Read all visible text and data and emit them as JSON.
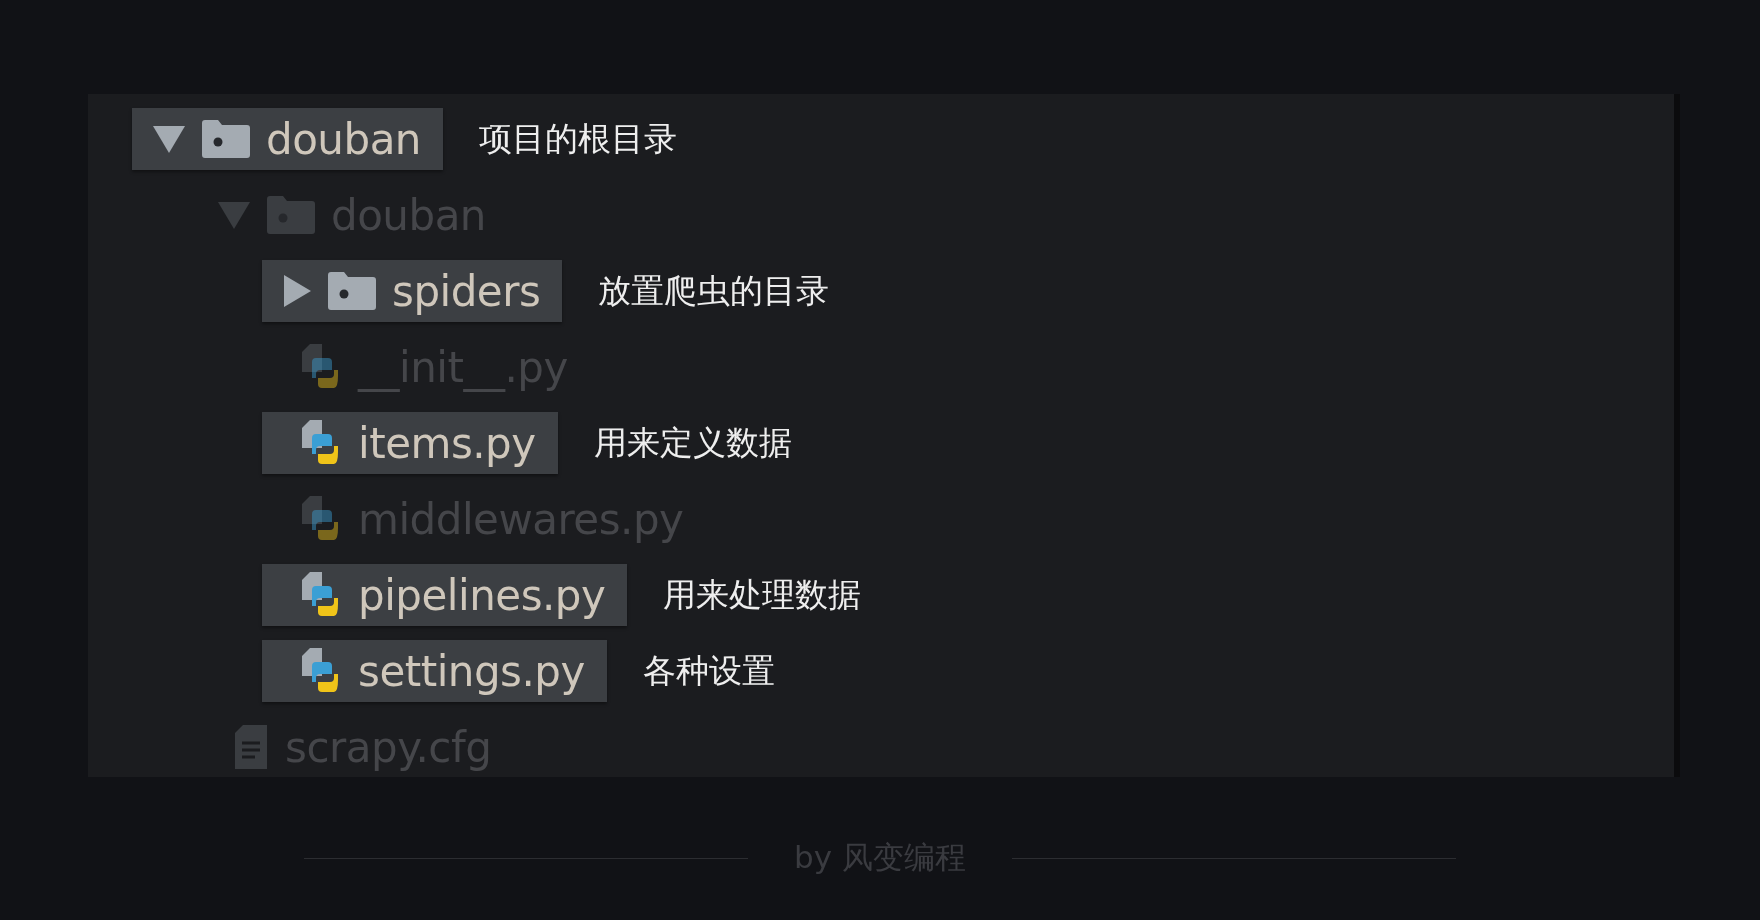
{
  "tree": [
    {
      "name": "douban",
      "kind": "folder",
      "expanded": true,
      "highlighted": true,
      "note": "项目的根目录",
      "children": [
        {
          "name": "douban",
          "kind": "folder",
          "expanded": true,
          "highlighted": false,
          "children": [
            {
              "name": "spiders",
              "kind": "folder",
              "expanded": false,
              "highlighted": true,
              "note": "放置爬虫的目录"
            },
            {
              "name": "__init__.py",
              "kind": "python",
              "highlighted": false
            },
            {
              "name": "items.py",
              "kind": "python",
              "highlighted": true,
              "note": "用来定义数据"
            },
            {
              "name": "middlewares.py",
              "kind": "python",
              "highlighted": false
            },
            {
              "name": "pipelines.py",
              "kind": "python",
              "highlighted": true,
              "note": "用来处理数据"
            },
            {
              "name": "settings.py",
              "kind": "python",
              "highlighted": true,
              "note": "各种设置"
            }
          ]
        },
        {
          "name": "scrapy.cfg",
          "kind": "file",
          "highlighted": false
        }
      ]
    }
  ],
  "footer": "by 风变编程"
}
